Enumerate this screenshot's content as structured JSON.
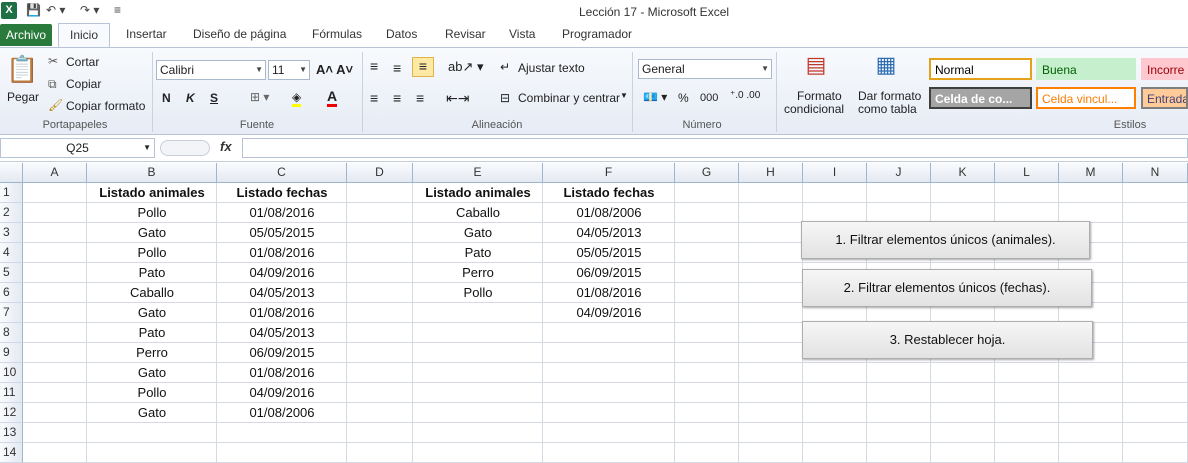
{
  "window": {
    "title": "Lección 17  -  Microsoft Excel"
  },
  "tabs": [
    "Archivo",
    "Inicio",
    "Insertar",
    "Diseño de página",
    "Fórmulas",
    "Datos",
    "Revisar",
    "Vista",
    "Programador"
  ],
  "ribbon": {
    "portapapeles": {
      "pegar": "Pegar",
      "cortar": "Cortar",
      "copiar": "Copiar",
      "copiar_formato": "Copiar formato",
      "label": "Portapapeles"
    },
    "fuente": {
      "font_name": "Calibri",
      "font_size": "11",
      "bold": "N",
      "italic": "K",
      "underline": "S",
      "label": "Fuente"
    },
    "alineacion": {
      "ajustar": "Ajustar texto",
      "combinar": "Combinar y centrar",
      "label": "Alineación"
    },
    "numero": {
      "format": "General",
      "percent": "%",
      "thousands": "000",
      "label": "Número"
    },
    "estilos": {
      "formato_condicional_1": "Formato",
      "formato_condicional_2": "condicional",
      "dar_formato_1": "Dar formato",
      "dar_formato_2": "como tabla",
      "label": "Estilos",
      "cells": [
        {
          "name": "Normal",
          "bg": "#ffffff",
          "fg": "#000000",
          "border": "#e3a21a"
        },
        {
          "name": "Buena",
          "bg": "#c6efce",
          "fg": "#006100",
          "border": "#c6efce"
        },
        {
          "name": "Incorre",
          "bg": "#ffc7ce",
          "fg": "#9c0006",
          "border": "#ffc7ce"
        },
        {
          "name": "Celda de co...",
          "bg": "#a5a5a5",
          "fg": "#ffffff",
          "border": "#3f3f3f"
        },
        {
          "name": "Celda vincul...",
          "bg": "#ffffff",
          "fg": "#fa7d00",
          "border": "#ff8001"
        },
        {
          "name": "Entrada",
          "bg": "#ffcc99",
          "fg": "#3f3f76",
          "border": "#7f7f7f"
        }
      ]
    }
  },
  "formula_bar": {
    "name_box": "Q25",
    "fx": "fx",
    "value": ""
  },
  "columns": [
    "A",
    "B",
    "C",
    "D",
    "E",
    "F",
    "G",
    "H",
    "I",
    "J",
    "K",
    "L",
    "M",
    "N"
  ],
  "rows": [
    "1",
    "2",
    "3",
    "4",
    "5",
    "6",
    "7",
    "8",
    "9",
    "10",
    "11",
    "12",
    "13",
    "14"
  ],
  "sheet": {
    "B": [
      "Listado animales",
      "Pollo",
      "Gato",
      "Pollo",
      "Pato",
      "Caballo",
      "Gato",
      "Pato",
      "Perro",
      "Gato",
      "Pollo",
      "Gato"
    ],
    "C": [
      "Listado fechas",
      "01/08/2016",
      "05/05/2015",
      "01/08/2016",
      "04/09/2016",
      "04/05/2013",
      "01/08/2016",
      "04/05/2013",
      "06/09/2015",
      "01/08/2016",
      "04/09/2016",
      "01/08/2006"
    ],
    "E": [
      "Listado animales",
      "Caballo",
      "Gato",
      "Pato",
      "Perro",
      "Pollo"
    ],
    "F": [
      "Listado fechas",
      "01/08/2006",
      "04/05/2013",
      "05/05/2015",
      "06/09/2015",
      "01/08/2016",
      "04/09/2016"
    ]
  },
  "buttons": {
    "btn1": "1. Filtrar elementos únicos (animales).",
    "btn2": "2. Filtrar elementos únicos (fechas).",
    "btn3": "3. Restablecer hoja."
  }
}
